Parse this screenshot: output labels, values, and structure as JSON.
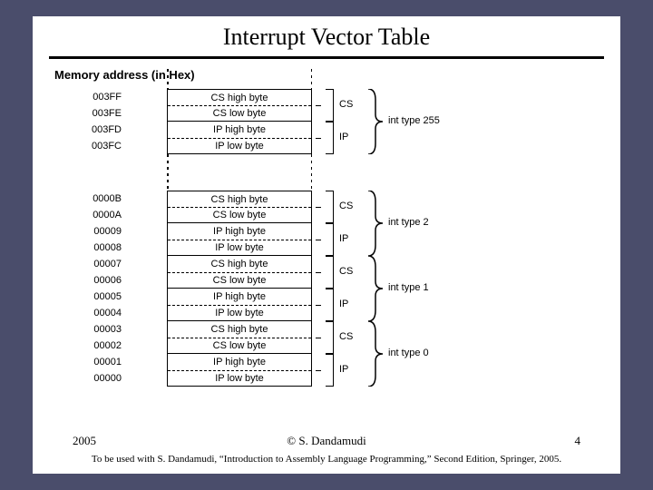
{
  "title": "Interrupt Vector Table",
  "mem_header": "Memory address (in Hex)",
  "rows": [
    {
      "addr": "003FF",
      "label": "CS high byte"
    },
    {
      "addr": "003FE",
      "label": "CS low byte"
    },
    {
      "addr": "003FD",
      "label": "IP high byte"
    },
    {
      "addr": "003FC",
      "label": "IP low byte"
    },
    {
      "addr": "0000B",
      "label": "CS high byte"
    },
    {
      "addr": "0000A",
      "label": "CS low byte"
    },
    {
      "addr": "00009",
      "label": "IP high byte"
    },
    {
      "addr": "00008",
      "label": "IP low byte"
    },
    {
      "addr": "00007",
      "label": "CS high byte"
    },
    {
      "addr": "00006",
      "label": "CS low byte"
    },
    {
      "addr": "00005",
      "label": "IP high byte"
    },
    {
      "addr": "00004",
      "label": "IP low byte"
    },
    {
      "addr": "00003",
      "label": "CS high byte"
    },
    {
      "addr": "00002",
      "label": "CS low byte"
    },
    {
      "addr": "00001",
      "label": "IP high byte"
    },
    {
      "addr": "00000",
      "label": "IP low byte"
    }
  ],
  "pair_labels": {
    "cs": "CS",
    "ip": "IP"
  },
  "type_labels": {
    "t255": "int type 255",
    "t2": "int type 2",
    "t1": "int type 1",
    "t0": "int type 0"
  },
  "footer": {
    "year": "2005",
    "copyright": "© S. Dandamudi",
    "page": "4",
    "citation": "To be used with S. Dandamudi, “Introduction to Assembly Language Programming,” Second Edition, Springer, 2005."
  }
}
